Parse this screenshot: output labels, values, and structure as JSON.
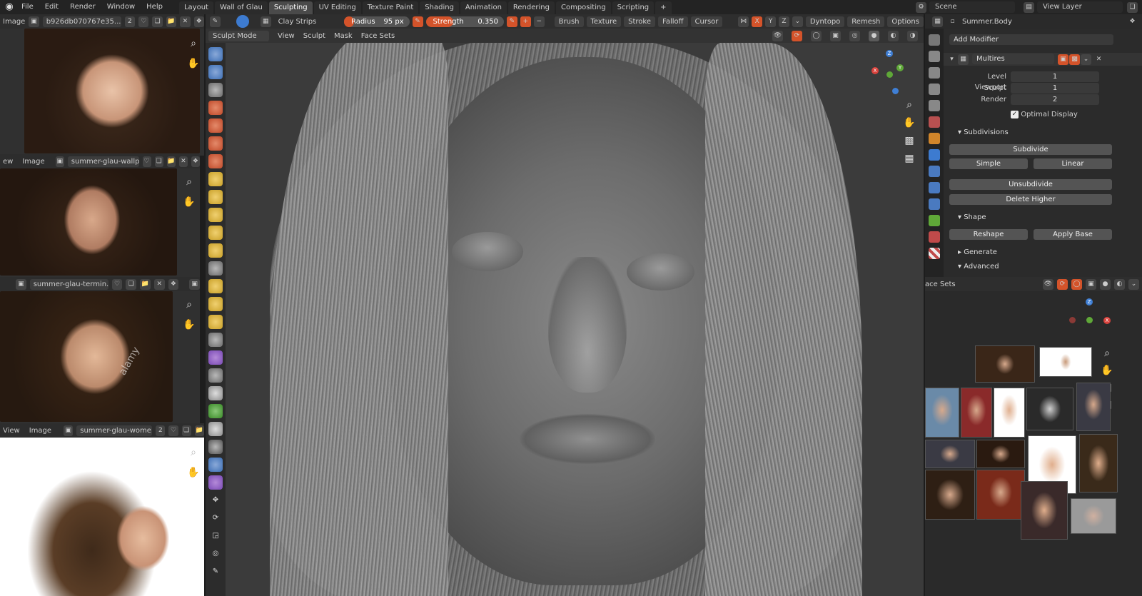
{
  "topbar": {
    "menus": [
      "File",
      "Edit",
      "Render",
      "Window",
      "Help"
    ],
    "workspaces": [
      "Layout",
      "Wall of Glau",
      "Sculpting",
      "UV Editing",
      "Texture Paint",
      "Shading",
      "Animation",
      "Rendering",
      "Compositing",
      "Scripting"
    ],
    "active_workspace": "Sculpting",
    "add_tab": "+",
    "scene": "Scene",
    "view_layer": "View Layer"
  },
  "image_editors": [
    {
      "menu": "Image",
      "filename": "b926db070767e35...",
      "users": "2"
    },
    {
      "menu_view": "ew",
      "menu": "Image",
      "filename": "summer-glau-wallpa..."
    },
    {
      "filename": "summer-glau-termin..."
    },
    {
      "menu_view": "View",
      "menu": "Image",
      "filename": "summer-glau-wome...",
      "users": "2"
    }
  ],
  "watermark": "alamy",
  "viewport": {
    "brush": "Clay Strips",
    "radius_label": "Radius",
    "radius_value": "95 px",
    "strength_label": "Strength",
    "strength_value": "0.350",
    "strength_fraction": 0.35,
    "dropdowns": [
      "Brush",
      "Texture",
      "Stroke",
      "Falloff",
      "Cursor"
    ],
    "axes": [
      "X",
      "Y",
      "Z"
    ],
    "dyntopo": "Dyntopo",
    "remesh": "Remesh",
    "options": "Options",
    "mode": "Sculpt Mode",
    "mode_menus": [
      "View",
      "Sculpt",
      "Mask",
      "Face Sets"
    ],
    "nav_axes": {
      "z": "Z",
      "x": "X",
      "y": "Y"
    }
  },
  "properties": {
    "object": "Summer.Body",
    "add_modifier": "Add Modifier",
    "modifier_name": "Multires",
    "level_viewport_label": "Level Viewport",
    "level_viewport": "1",
    "sculpt_label": "Sculpt",
    "sculpt": "1",
    "render_label": "Render",
    "render": "2",
    "optimal_display": "Optimal Display",
    "subdivisions": "Subdivisions",
    "subdivide": "Subdivide",
    "simple": "Simple",
    "linear": "Linear",
    "unsubdivide": "Unsubdivide",
    "delete_higher": "Delete Higher",
    "shape": "Shape",
    "reshape": "Reshape",
    "apply_base": "Apply Base",
    "generate": "Generate",
    "advanced": "Advanced"
  },
  "browser": {
    "header_label": "ace Sets",
    "axes": {
      "z": "Z",
      "x": "X"
    }
  },
  "colors": {
    "accent": "#d4532a",
    "active_tab": "#4a4a4a",
    "viewport_bg": "#3b3b3b",
    "axis_x": "#d9423c",
    "axis_y": "#5fa838",
    "axis_z": "#3f7fd5"
  }
}
